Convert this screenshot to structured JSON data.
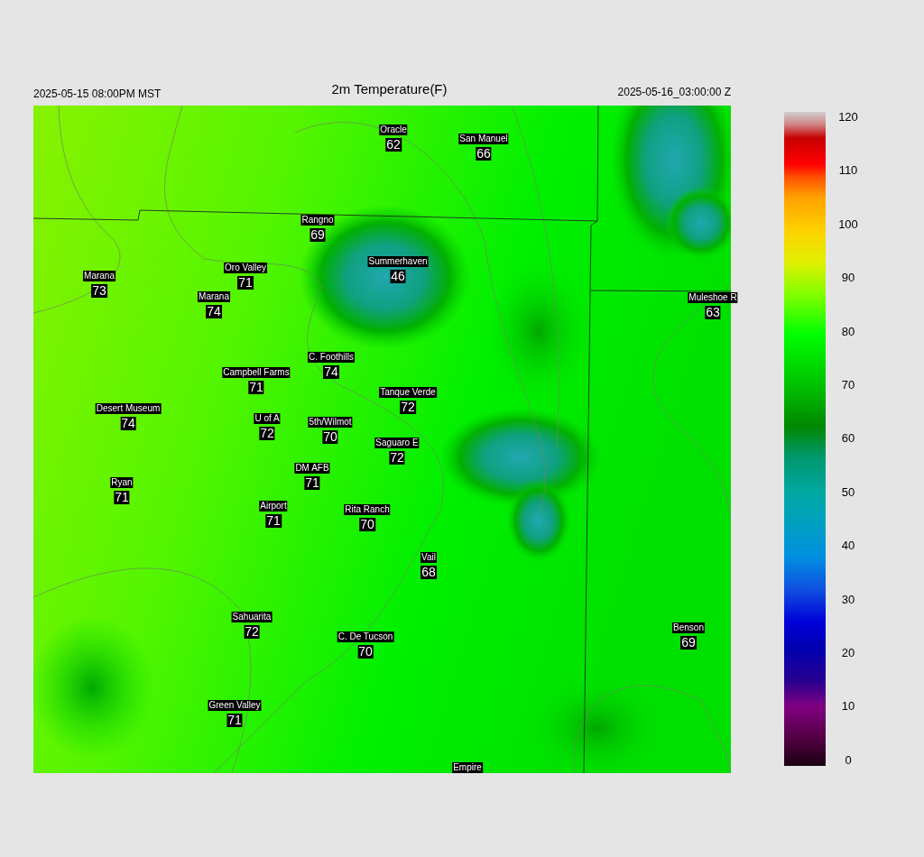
{
  "header": {
    "valid_time": "2025-05-15 08:00PM MST",
    "title": "2m Temperature(F)",
    "model_time": "2025-05-16_03:00:00 Z"
  },
  "stations": [
    {
      "name": "Oracle",
      "value": "62"
    },
    {
      "name": "San Manuel",
      "value": "66"
    },
    {
      "name": "Rangno",
      "value": "69"
    },
    {
      "name": "Summerhaven",
      "value": "46"
    },
    {
      "name": "Marana",
      "value": "73"
    },
    {
      "name": "Oro Valley",
      "value": "71"
    },
    {
      "name": "Marana",
      "value": "74"
    },
    {
      "name": "Muleshoe R",
      "value": "63"
    },
    {
      "name": "C. Foothills",
      "value": "74"
    },
    {
      "name": "Campbell Farms",
      "value": "71"
    },
    {
      "name": "Tanque Verde",
      "value": "72"
    },
    {
      "name": "Desert Museum",
      "value": "74"
    },
    {
      "name": "U of A",
      "value": "72"
    },
    {
      "name": "5th/Wilmot",
      "value": "70"
    },
    {
      "name": "Saguaro E",
      "value": "72"
    },
    {
      "name": "DM AFB",
      "value": "71"
    },
    {
      "name": "Ryan",
      "value": "71"
    },
    {
      "name": "Airport",
      "value": "71"
    },
    {
      "name": "Rita Ranch",
      "value": "70"
    },
    {
      "name": "Vail",
      "value": "68"
    },
    {
      "name": "Sahuarita",
      "value": "72"
    },
    {
      "name": "Benson",
      "value": "69"
    },
    {
      "name": "C. De Tucson",
      "value": "70"
    },
    {
      "name": "Green Valley",
      "value": "71"
    },
    {
      "name": "Empire"
    }
  ],
  "colorbar": {
    "ticks": [
      "120",
      "110",
      "100",
      "90",
      "80",
      "70",
      "60",
      "50",
      "40",
      "30",
      "20",
      "10",
      "0"
    ]
  }
}
